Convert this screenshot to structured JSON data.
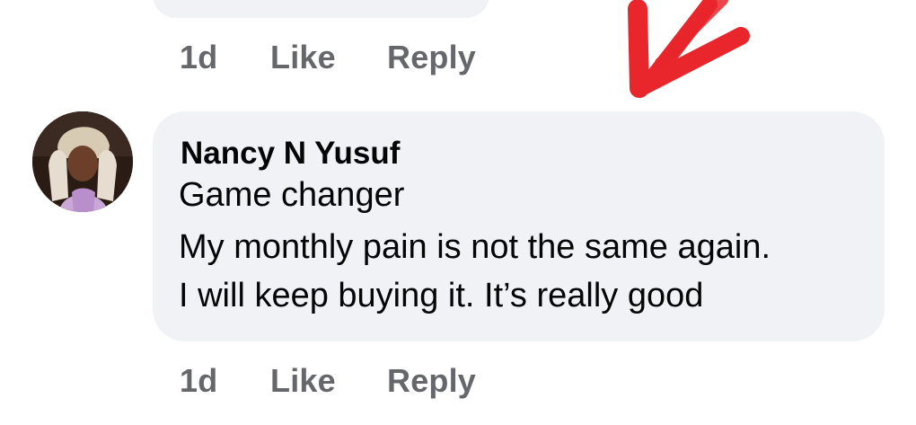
{
  "previous_comment": {
    "meta": {
      "time": "1d",
      "like_label": "Like",
      "reply_label": "Reply"
    }
  },
  "comment": {
    "author": "Nancy N Yusuf",
    "lines": [
      "Game changer",
      "My monthly pain is not the same again.",
      "I will keep buying it. It’s really good"
    ],
    "meta": {
      "time": "1d",
      "like_label": "Like",
      "reply_label": "Reply"
    }
  },
  "colors": {
    "bubble_background": "#f0f2f5",
    "meta_text": "#65676b",
    "arrow_annotation": "#e8262b"
  },
  "icons": {
    "annotation": "red-arrow-icon"
  }
}
